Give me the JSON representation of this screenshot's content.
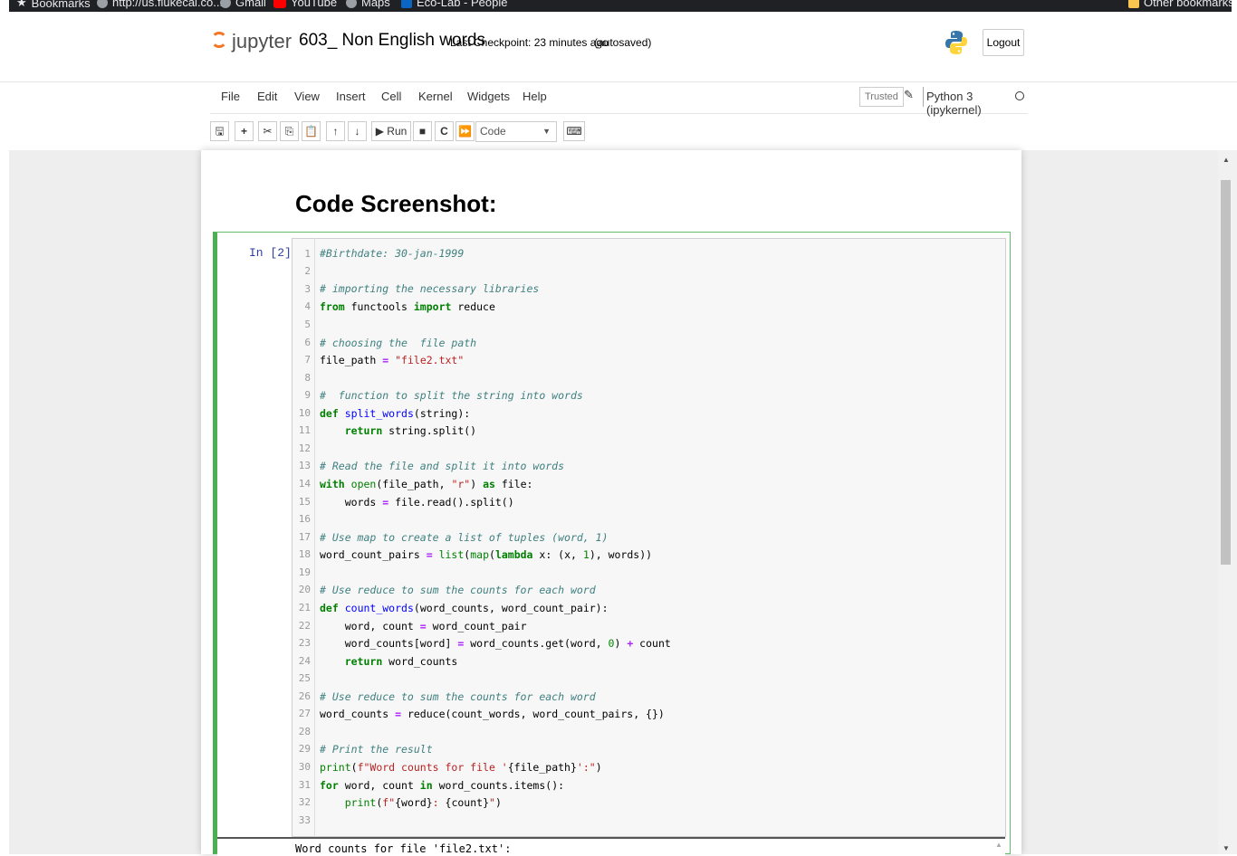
{
  "bookmarks": [
    {
      "label": "Bookmarks",
      "icon": "star-icon"
    },
    {
      "label": "http://us.flukecal.co...",
      "icon": "globe-icon"
    },
    {
      "label": "Gmail",
      "icon": "globe-icon"
    },
    {
      "label": "YouTube",
      "icon": "youtube-icon"
    },
    {
      "label": "Maps",
      "icon": "globe-icon"
    },
    {
      "label": "Eco-Lab - People",
      "icon": "linkedin-icon"
    },
    {
      "label": "Other bookmarks",
      "icon": "folder-icon"
    }
  ],
  "header": {
    "logo_text": "jupyter",
    "notebook_name": "603_ Non English words",
    "checkpoint": "Last Checkpoint: 23 minutes ago",
    "autosave": "(autosaved)",
    "logout": "Logout"
  },
  "menubar": {
    "items": [
      "File",
      "Edit",
      "View",
      "Insert",
      "Cell",
      "Kernel",
      "Widgets",
      "Help"
    ],
    "trusted": "Trusted",
    "kernel": "Python 3 (ipykernel)"
  },
  "toolbar": {
    "run_label": "Run",
    "cell_type": "Code"
  },
  "notebook": {
    "heading": "Code Screenshot:",
    "prompt": "In [2]:",
    "output_text": "Word counts for file 'file2.txt':"
  },
  "colors": {
    "accent_green": "#4caf50",
    "jupyter_orange": "#f37726",
    "prompt_blue": "#303f9f"
  }
}
